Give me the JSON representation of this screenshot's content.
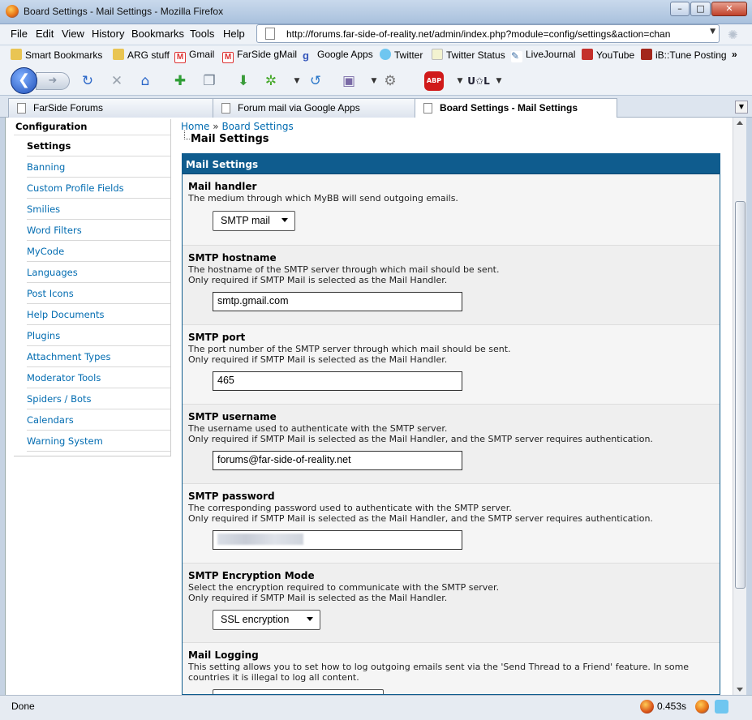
{
  "window": {
    "title": "Board Settings - Mail Settings - Mozilla Firefox"
  },
  "menubar": {
    "items": [
      "File",
      "Edit",
      "View",
      "History",
      "Bookmarks",
      "Tools",
      "Help"
    ]
  },
  "address_bar": {
    "url": "http://forums.far-side-of-reality.net/admin/index.php?module=config/settings&action=chan"
  },
  "bookmarks": [
    "Smart Bookmarks",
    "ARG stuff",
    "Gmail",
    "FarSide gMail",
    "Google Apps",
    "Twitter",
    "Twitter Status",
    "LiveJournal",
    "YouTube",
    "iB::Tune Posting"
  ],
  "tabs": [
    {
      "label": "FarSide Forums",
      "active": false
    },
    {
      "label": "Forum mail via Google Apps",
      "active": false
    },
    {
      "label": "Board Settings - Mail Settings",
      "active": true
    }
  ],
  "sidebar": {
    "heading": "Configuration",
    "items": [
      "Settings",
      "Banning",
      "Custom Profile Fields",
      "Smilies",
      "Word Filters",
      "MyCode",
      "Languages",
      "Post Icons",
      "Help Documents",
      "Plugins",
      "Attachment Types",
      "Moderator Tools",
      "Spiders / Bots",
      "Calendars",
      "Warning System"
    ],
    "active_index": 0
  },
  "breadcrumb": {
    "home": "Home",
    "separator": "»",
    "section": "Board Settings"
  },
  "page_title": "Mail Settings",
  "panel": {
    "heading": "Mail Settings",
    "settings": [
      {
        "label": "Mail handler",
        "desc1": "The medium through which MyBB will send outgoing emails.",
        "desc2": "",
        "type": "select",
        "value": "SMTP mail"
      },
      {
        "label": "SMTP hostname",
        "desc1": "The hostname of the SMTP server through which mail should be sent.",
        "desc2": "Only required if SMTP Mail is selected as the Mail Handler.",
        "type": "text",
        "value": "smtp.gmail.com"
      },
      {
        "label": "SMTP port",
        "desc1": "The port number of the SMTP server through which mail should be sent.",
        "desc2": "Only required if SMTP Mail is selected as the Mail Handler.",
        "type": "text",
        "value": "465"
      },
      {
        "label": "SMTP username",
        "desc1": "The username used to authenticate with the SMTP server.",
        "desc2": "Only required if SMTP Mail is selected as the Mail Handler, and the SMTP server requires authentication.",
        "type": "text",
        "value": "forums@far-side-of-reality.net"
      },
      {
        "label": "SMTP password",
        "desc1": "The corresponding password used to authenticate with the SMTP server.",
        "desc2": "Only required if SMTP Mail is selected as the Mail Handler, and the SMTP server requires authentication.",
        "type": "password",
        "value": ""
      },
      {
        "label": "SMTP Encryption Mode",
        "desc1": "Select the encryption required to communicate with the SMTP server.",
        "desc2": "Only required if SMTP Mail is selected as the Mail Handler.",
        "type": "select",
        "value": "SSL encryption"
      },
      {
        "label": "Mail Logging",
        "desc1": "This setting allows you to set how to log outgoing emails sent via the 'Send Thread to a Friend' feature. In some",
        "desc2": "countries it is illegal to log all content.",
        "type": "select",
        "value": ""
      }
    ]
  },
  "statusbar": {
    "status": "Done",
    "timing": "0.453s"
  },
  "colors": {
    "panel_header": "#0f5c8e",
    "link": "#026cb1"
  }
}
